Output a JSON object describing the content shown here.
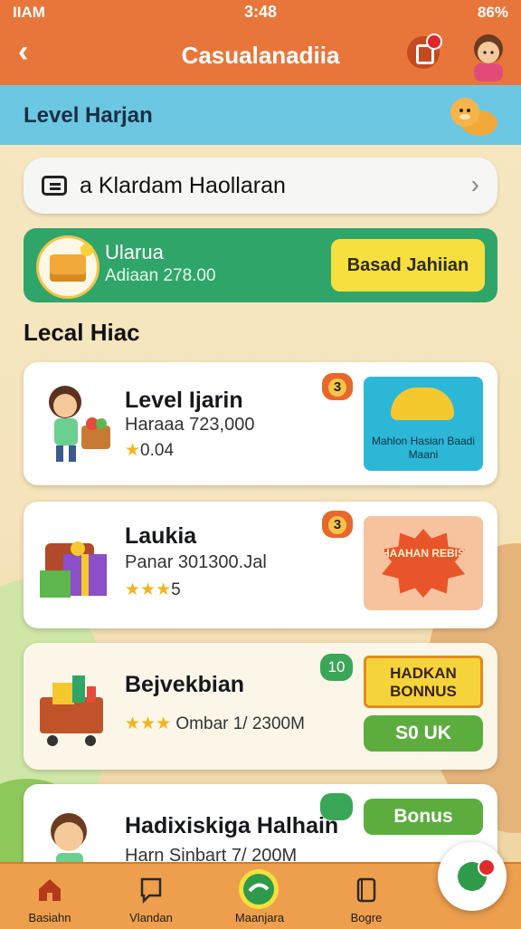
{
  "status_bar": {
    "carrier": "IIAM",
    "time": "3:48",
    "battery": "86%"
  },
  "app_bar": {
    "title": "Casualanadiia"
  },
  "banner": {
    "title": "Level Harjan"
  },
  "search": {
    "text": "a Klardam Haollaran"
  },
  "green_card": {
    "title": "Ularua",
    "subtitle": "Adiaan 278.00",
    "button": "Basad Jahiian"
  },
  "section_title": "Lecal Hiac",
  "items": [
    {
      "name": "Level Ijarin",
      "sub": "Haraaa 723,000",
      "stars": "★",
      "rating": "0.04",
      "badge": "3",
      "promo_text": "Mahlon Hasian Baadi Maani",
      "colors": {
        "promo": "#2db7d6"
      }
    },
    {
      "name": "Laukia",
      "sub": "Panar 301300.Jal",
      "stars": "★★★",
      "rating": "5",
      "badge": "3",
      "promo_text": "HAAHAN REBIS",
      "colors": {
        "promo": "#e9552b"
      }
    },
    {
      "name": "Bejvekbian",
      "sub": "Ombar 1/ 2300M",
      "stars": "★★★",
      "rating": "",
      "badge": "10",
      "promo_text": "HADKAN BONNUS",
      "button": "S0 UK"
    },
    {
      "name": "Hadixiskiga Halhain",
      "sub": "Harn Sinbart 7/ 200M",
      "button": "Bonus"
    }
  ],
  "tabs": [
    {
      "label": "Basiahn",
      "icon": "home-icon"
    },
    {
      "label": "Vlandan",
      "icon": "chat-icon"
    },
    {
      "label": "Maanjara",
      "icon": "center-badge-icon"
    },
    {
      "label": "Bogre",
      "icon": "book-icon"
    }
  ],
  "colors": {
    "accent": "#e8763a",
    "banner": "#6cc7e2",
    "green": "#2fa56a",
    "tabbar": "#ee9f4d"
  }
}
